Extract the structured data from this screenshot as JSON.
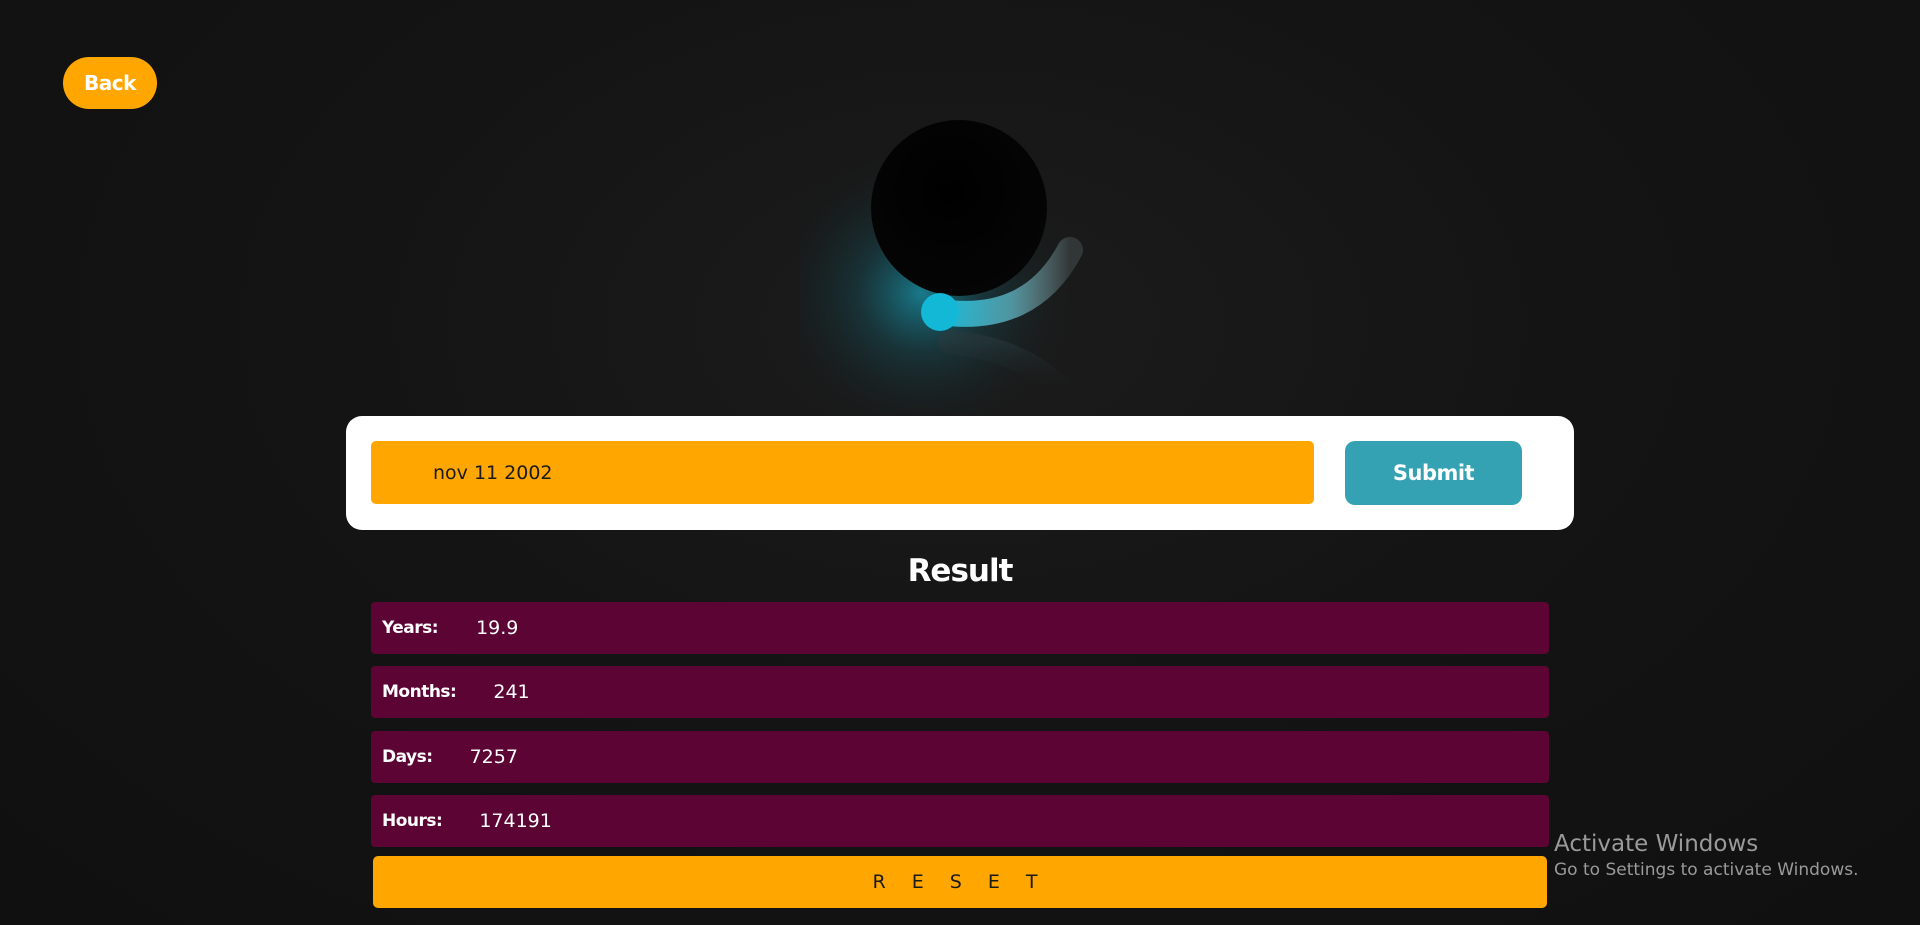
{
  "header": {
    "back_label": "Back"
  },
  "form": {
    "date_value": "nov 11 2002",
    "submit_label": "Submit"
  },
  "result": {
    "title": "Result",
    "rows": [
      {
        "label": "Years:",
        "value": "19.9"
      },
      {
        "label": "Months:",
        "value": "241"
      },
      {
        "label": "Days:",
        "value": "7257"
      },
      {
        "label": "Hours:",
        "value": "174191"
      }
    ],
    "reset_label": "R E S E T"
  },
  "overlay": {
    "activate_title": "Activate Windows",
    "activate_subtitle": "Go to Settings to activate Windows."
  },
  "colors": {
    "accent_orange": "#ffa600",
    "submit_teal": "#35a2b3",
    "row_maroon": "#5c0433",
    "background": "#141414"
  },
  "icons": {
    "illustration": "glowing-orb-illustration"
  }
}
